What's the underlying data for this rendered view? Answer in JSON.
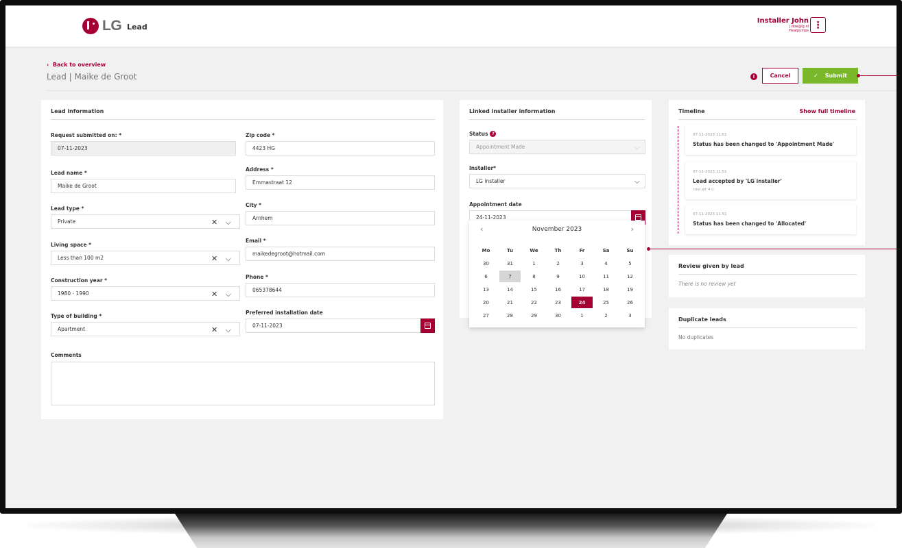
{
  "app": {
    "title": "Lead",
    "logo_text": "LG"
  },
  "user": {
    "name": "Installer John",
    "email": "j.doe@lg.nl",
    "group": "Heatpumps",
    "menu_icon": "kebab-menu-icon"
  },
  "nav": {
    "back_label": "Back to overview",
    "page_title": "Lead | Maike de Groot"
  },
  "actions": {
    "info_icon": "info-icon",
    "cancel_label": "Cancel",
    "submit_label": "Submit",
    "submit_icon": "checkmark-icon"
  },
  "lead_info": {
    "title": "Lead information",
    "request_submitted_label": "Request submitted on: *",
    "request_submitted_value": "07-11-2023",
    "zip_label": "Zip code *",
    "zip_value": "4423 HG",
    "lead_name_label": "Lead name *",
    "lead_name_value": "Maike de Groot",
    "address_label": "Address *",
    "address_value": "Emmastraat 12",
    "lead_type_label": "Lead type *",
    "lead_type_value": "Private",
    "city_label": "City *",
    "city_value": "Arnhem",
    "living_space_label": "Living space *",
    "living_space_value": "Less than 100 m2",
    "email_label": "Email *",
    "email_value": "maikedegroot@hotmail.com",
    "construction_year_label": "Construction year *",
    "construction_year_value": "1980 - 1990",
    "phone_label": "Phone *",
    "phone_value": "065378644",
    "building_type_label": "Type of building *",
    "building_type_value": "Apartment",
    "preferred_date_label": "Preferred installation date",
    "preferred_date_value": "07-11-2023",
    "comments_label": "Comments",
    "comments_value": ""
  },
  "linked_installer": {
    "title": "Linked installer information",
    "status_label": "Status",
    "status_value": "Appointment Made",
    "installer_label": "Installer*",
    "installer_value": "LG installer",
    "appointment_label": "Appointment date",
    "appointment_value": "24-11-2023"
  },
  "calendar": {
    "month_label": "November 2023",
    "weekdays": [
      "Mo",
      "Tu",
      "We",
      "Th",
      "Fr",
      "Sa",
      "Su"
    ],
    "weeks": [
      [
        "30",
        "31",
        "1",
        "2",
        "3",
        "4",
        "5"
      ],
      [
        "6",
        "7",
        "8",
        "9",
        "10",
        "11",
        "12"
      ],
      [
        "13",
        "14",
        "15",
        "16",
        "17",
        "18",
        "19"
      ],
      [
        "20",
        "21",
        "22",
        "23",
        "24",
        "25",
        "26"
      ],
      [
        "27",
        "28",
        "29",
        "30",
        "1",
        "2",
        "3"
      ]
    ],
    "today": "7",
    "selected": "24"
  },
  "timeline": {
    "title": "Timeline",
    "show_full_label": "Show full timeline",
    "entries": [
      {
        "time": "07-11-2023 11:51",
        "text": "Status has been changed to 'Appointment Made'",
        "note": ""
      },
      {
        "time": "07-11-2023 11:51",
        "text": "Lead accepted by 'LG installer'",
        "note": "cool air 4 u"
      },
      {
        "time": "07-11-2023 11:51",
        "text": "Status has been changed to 'Allocated'",
        "note": ""
      }
    ]
  },
  "review": {
    "title": "Review given by lead",
    "empty_text": "There is no review yet"
  },
  "duplicates": {
    "title": "Duplicate leads",
    "empty_text": "No duplicates"
  },
  "colors": {
    "brand": "#a50034",
    "submit_green": "#7ab829",
    "screen_bg": "#f1f1f1"
  }
}
